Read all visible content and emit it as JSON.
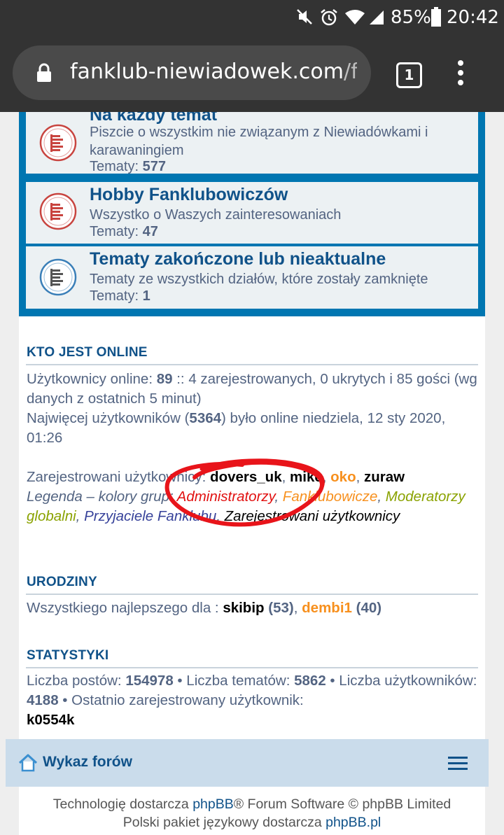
{
  "status_bar": {
    "battery": "85%",
    "time": "20:42"
  },
  "browser": {
    "url_host": "fanklub-niewiadowek.com",
    "url_rest": "/fo",
    "tab_count": "1"
  },
  "forums": [
    {
      "title": "Na każdy temat",
      "description": "Piszcie o wszystkim nie związanym z Niewiadówkami i karawaningiem",
      "topics_label": "Tematy:",
      "topics_count": "577"
    },
    {
      "title": "Hobby Fanklubowiczów",
      "description": "Wszystko o Waszych zainteresowaniach",
      "topics_label": "Tematy:",
      "topics_count": "47"
    },
    {
      "title": "Tematy zakończone lub nieaktualne",
      "description": "Tematy ze wszystkich działów, które zostały zamknięte",
      "topics_label": "Tematy:",
      "topics_count": "1"
    }
  ],
  "online": {
    "heading": "KTO JEST ONLINE",
    "line1_prefix": "Użytkownicy online: ",
    "total": "89",
    "line1_suffix": " :: 4 zarejestrowanych, 0 ukrytych i 85 gości (wg danych z ostatnich 5 minut)",
    "line2_prefix": "Najwięcej użytkowników (",
    "max_users": "5364",
    "line2_suffix": ") było online niedziela, 12 sty 2020, 01:26",
    "registered_label": "Zarejestrowani użytkownicy: ",
    "users": [
      {
        "name": "dovers_uk",
        "sep": ", "
      },
      {
        "name": "mike",
        "sep": ", "
      },
      {
        "name": "oko",
        "sep": ", "
      },
      {
        "name": "zuraw",
        "sep": ""
      }
    ],
    "legend_label": "Legenda – kolory grup: ",
    "groups": [
      "Administratorzy",
      "Fanklubowicze",
      "Moderatorzy globalni",
      "Przyjaciele Fanklubu",
      "Zarejestrowani użytkownicy"
    ]
  },
  "birthdays": {
    "heading": "URODZINY",
    "prefix": "Wszystkiego najlepszego dla : ",
    "people": [
      {
        "name": "skibip",
        "age": "(53)"
      },
      {
        "name": "dembi1",
        "age": "(40)"
      }
    ]
  },
  "stats": {
    "heading": "STATYSTYKI",
    "posts_label": "Liczba postów: ",
    "posts": "154978",
    "topics_label": " • Liczba tematów: ",
    "topics": "5862",
    "users_label": " • Liczba użytkowników: ",
    "users": "4188",
    "newest_label": " • Ostatnio zarejestrowany użytkownik:",
    "newest_user": "k0554k"
  },
  "nav": {
    "index_label": "Wykaz forów"
  },
  "footer": {
    "line1_prefix": "Technologię dostarcza ",
    "line1_link": "phpBB",
    "line1_suffix": "® Forum Software © phpBB Limited",
    "line2_prefix": "Polski pakiet językowy dostarcza ",
    "line2_link": "phpBB.pl"
  },
  "colors": {
    "accent": "#105289",
    "forum_border": "#0076b1",
    "admin": "#e11010",
    "fan": "#f7901e",
    "moderator": "#8aa200",
    "friend": "#37429a",
    "annotation": "#e8141a"
  }
}
